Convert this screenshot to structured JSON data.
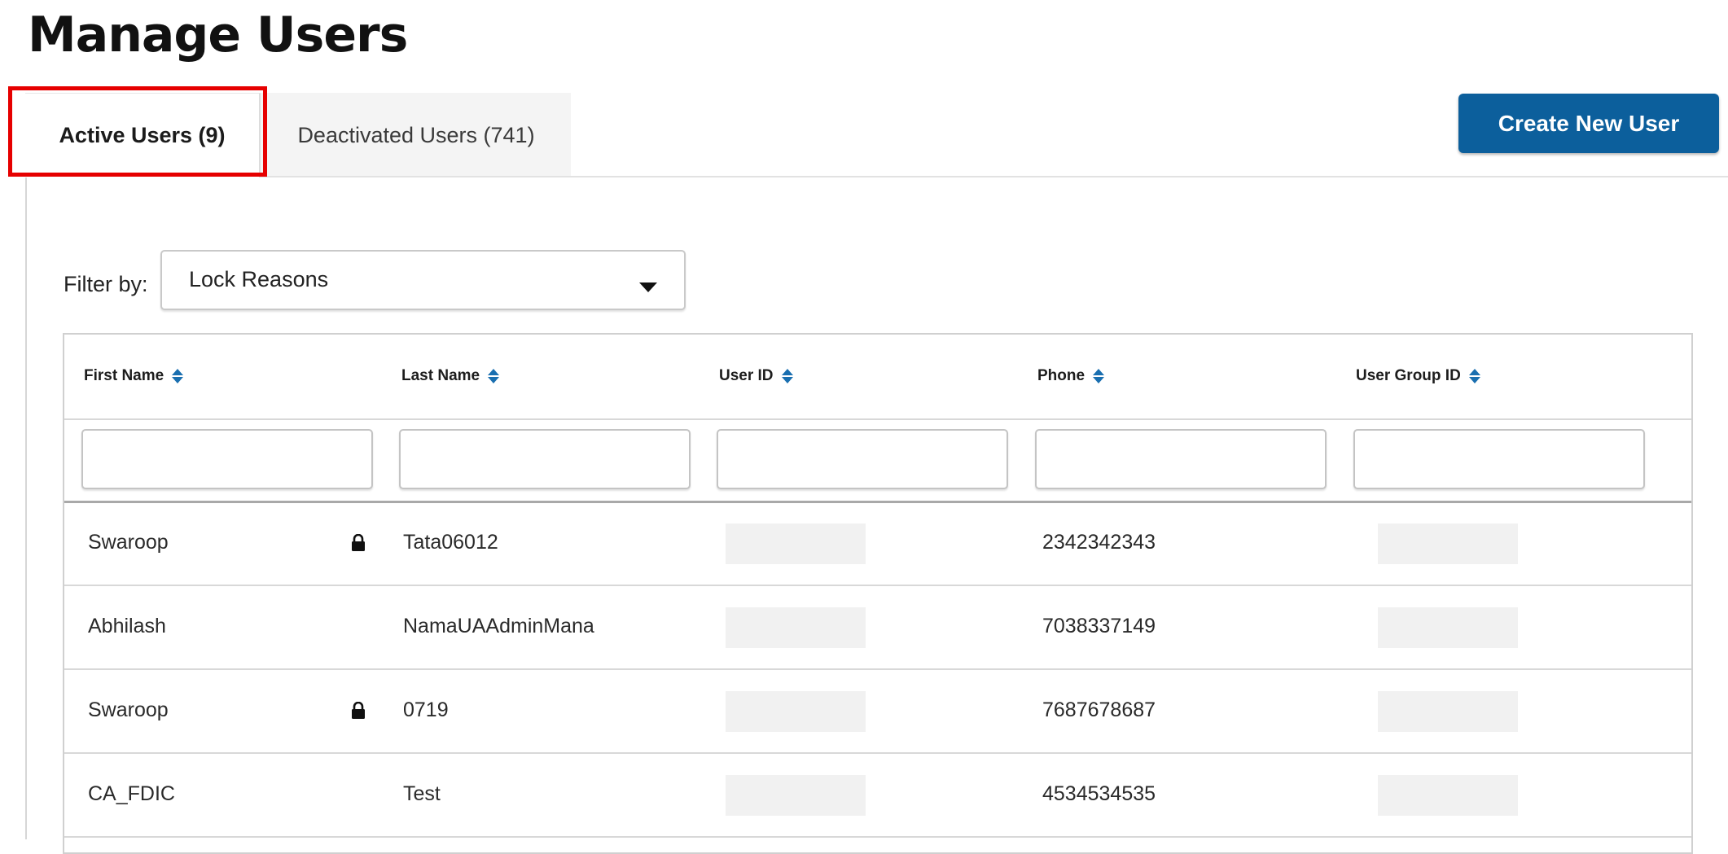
{
  "page": {
    "title": "Manage Users"
  },
  "tabs": {
    "active": {
      "label": "Active Users (9)"
    },
    "inactive": {
      "label": "Deactivated Users (741)"
    }
  },
  "actions": {
    "create_label": "Create New User"
  },
  "filter": {
    "label": "Filter by:",
    "selected": "Lock Reasons"
  },
  "table": {
    "columns": [
      "First Name",
      "Last Name",
      "User ID",
      "Phone",
      "User Group ID"
    ],
    "rows": [
      {
        "first": "Swaroop",
        "last": "Tata06012",
        "phone": "2342342343",
        "locked": true
      },
      {
        "first": "Abhilash",
        "last": "NamaUAAdminMana",
        "phone": "7038337149",
        "locked": false
      },
      {
        "first": "Swaroop",
        "last": "0719",
        "phone": "7687678687",
        "locked": true
      },
      {
        "first": "CA_FDIC",
        "last": "Test",
        "phone": "4534534535",
        "locked": false
      }
    ]
  },
  "colors": {
    "primary": "#0c5f9c",
    "highlight": "#e60000",
    "sort_icon": "#1a6fb0"
  },
  "icons": {
    "sort": "sort-icon",
    "lock": "lock-icon",
    "dropdown": "chevron-down-icon"
  }
}
